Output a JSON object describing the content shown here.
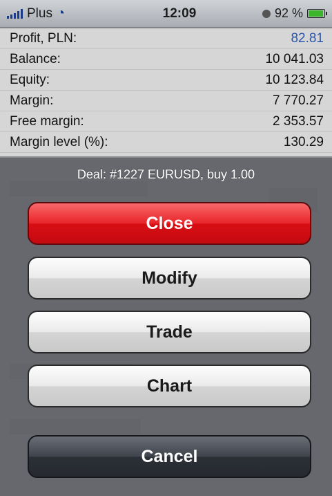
{
  "status_bar": {
    "carrier": "Plus",
    "time": "12:09",
    "battery_percent": "92 %"
  },
  "summary": [
    {
      "label": "Profit, PLN:",
      "value": "82.81"
    },
    {
      "label": "Balance:",
      "value": "10 041.03"
    },
    {
      "label": "Equity:",
      "value": "10 123.84"
    },
    {
      "label": "Margin:",
      "value": "7 770.27"
    },
    {
      "label": "Free margin:",
      "value": "2 353.57"
    },
    {
      "label": "Margin level (%):",
      "value": "130.29"
    }
  ],
  "sheet": {
    "title": "Deal: #1227 EURUSD, buy 1.00",
    "close_label": "Close",
    "modify_label": "Modify",
    "trade_label": "Trade",
    "chart_label": "Chart",
    "cancel_label": "Cancel"
  },
  "colors": {
    "profit_value": "#2b55a8",
    "close_button": "#e8242a"
  }
}
